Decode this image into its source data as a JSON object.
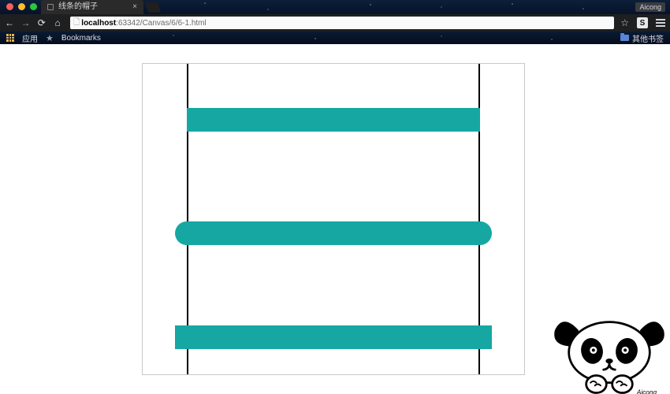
{
  "window": {
    "traffic": [
      "close",
      "minimize",
      "zoom"
    ],
    "account_label": "Aicong"
  },
  "tab": {
    "title": "线条的帽子",
    "favicon_name": "blank-favicon",
    "close_glyph": "×",
    "newtab_name": "new-tab-button"
  },
  "toolbar": {
    "back_glyph": "←",
    "forward_glyph": "→",
    "reload_glyph": "⟳",
    "home_glyph": "⌂",
    "url_scheme_glyph": "🗋",
    "url_host": "localhost",
    "url_rest": ":63342/Canvas/6/6-1.html",
    "star_glyph": "☆",
    "ext_letter": "S",
    "menu_name": "hamburger-menu"
  },
  "bookmarks": {
    "apps_label": "应用",
    "bookmarks_label": "Bookmarks",
    "other_label": "其他书签"
  },
  "content": {
    "canvas": {
      "border_color": "#c9c9c9",
      "stripe_color": "#16a7a3",
      "guide_color": "#000000",
      "linecaps": [
        "butt",
        "round",
        "square"
      ]
    }
  },
  "decoration": {
    "character_name": "panda-character",
    "signature": "Aicong"
  }
}
